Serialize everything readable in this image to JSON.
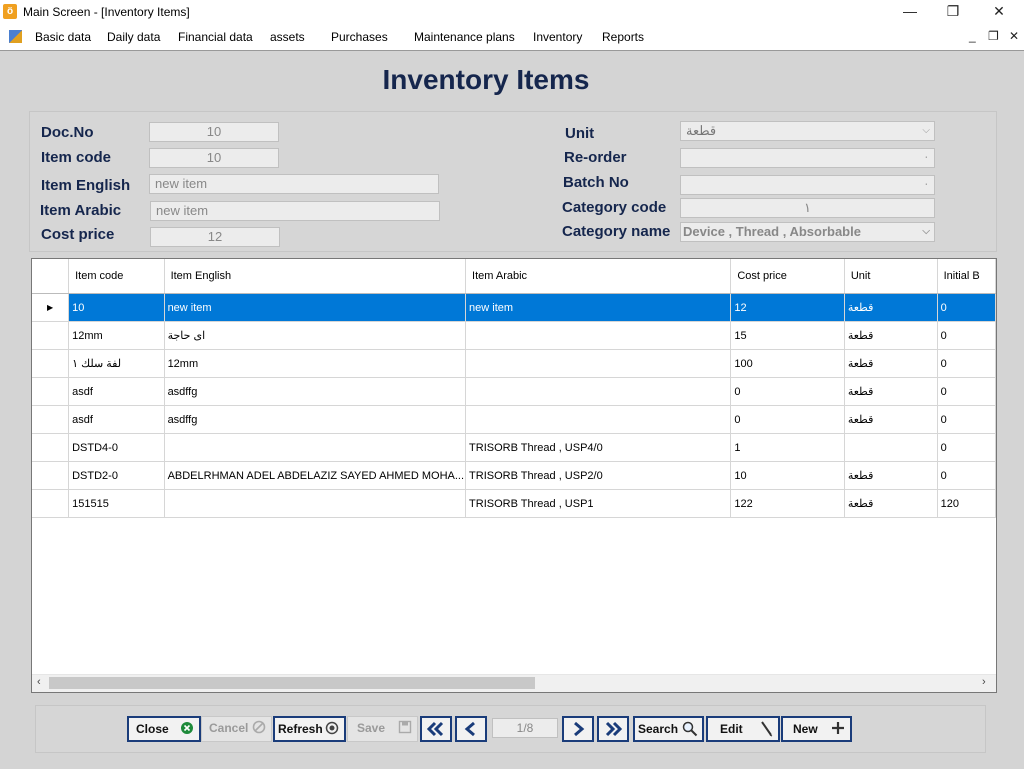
{
  "window": {
    "title": "Main Screen - [Inventory Items]",
    "buttons": {
      "minimize": "—",
      "maximize": "❐",
      "close": "✕"
    }
  },
  "menu": {
    "items": [
      "Basic data",
      "Daily data",
      "Financial data",
      "assets",
      "Purchases",
      "Maintenance plans",
      "Inventory",
      "Reports"
    ],
    "mdi": {
      "minimize": "_",
      "restore": "❐",
      "close": "✕"
    }
  },
  "form": {
    "title": "Inventory Items",
    "fields": {
      "doc_no": {
        "label": "Doc.No",
        "value": "10"
      },
      "item_code": {
        "label": "Item code",
        "value": "10"
      },
      "item_english": {
        "label": "Item English",
        "value": "new item"
      },
      "item_arabic": {
        "label": "Item Arabic",
        "value": "new item"
      },
      "cost_price": {
        "label": "Cost price",
        "value": "12"
      },
      "unit": {
        "label": "Unit",
        "value": "قطعة"
      },
      "reorder": {
        "label": "Re-order",
        "value": "٠"
      },
      "batch_no": {
        "label": "Batch No",
        "value": "٠"
      },
      "category_code": {
        "label": "Category code",
        "value": "١"
      },
      "category_name": {
        "label": "Category name",
        "value": "Device , Thread , Absorbable"
      }
    }
  },
  "grid": {
    "columns": [
      "Item code",
      "Item English",
      "Item Arabic",
      "Cost price",
      "Unit",
      "Initial B"
    ],
    "rows": [
      {
        "code": "10",
        "english": "new item",
        "arabic": "new item",
        "cost": "12",
        "unit": "قطعة",
        "initial": "0",
        "selected": true
      },
      {
        "code": "12mm",
        "english": "اى حاجة",
        "arabic": "",
        "cost": "15",
        "unit": "قطعة",
        "initial": "0"
      },
      {
        "code": "لفة سلك ١",
        "english": "12mm",
        "arabic": "",
        "cost": "100",
        "unit": "قطعة",
        "initial": "0"
      },
      {
        "code": "asdf",
        "english": "asdffg",
        "arabic": "",
        "cost": "0",
        "unit": "قطعة",
        "initial": "0"
      },
      {
        "code": "asdf",
        "english": "asdffg",
        "arabic": "",
        "cost": "0",
        "unit": "قطعة",
        "initial": "0"
      },
      {
        "code": "DSTD4-0",
        "english": "",
        "arabic": "TRISORB Thread , USP4/0",
        "cost": "1",
        "unit": "",
        "initial": "0"
      },
      {
        "code": "DSTD2-0",
        "english": "ABDELRHMAN ADEL ABDELAZIZ SAYED AHMED MOHA...",
        "arabic": "TRISORB Thread , USP2/0",
        "cost": "10",
        "unit": "قطعة",
        "initial": "0"
      },
      {
        "code": "151515",
        "english": "",
        "arabic": "TRISORB Thread , USP1",
        "cost": "122",
        "unit": "قطعة",
        "initial": "120"
      }
    ],
    "current_row_marker": "▶",
    "scroll_left": "‹",
    "scroll_right": "›"
  },
  "toolbar": {
    "close": "Close",
    "cancel": "Cancel",
    "refresh": "Refresh",
    "save": "Save",
    "pager": "1/8",
    "search": "Search",
    "edit": "Edit",
    "new": "New"
  },
  "colors": {
    "selection": "#0078d7",
    "label": "#15264d",
    "button_border": "#1a3c7a"
  }
}
